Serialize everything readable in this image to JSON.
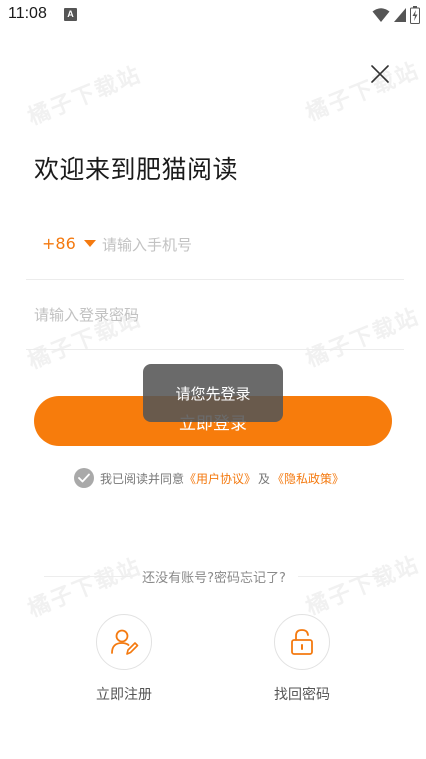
{
  "status_bar": {
    "time": "11:08",
    "notification_glyph": "A"
  },
  "watermark_text": "橘子下载站",
  "welcome_title": "欢迎来到肥猫阅读",
  "phone": {
    "country_code": "+86",
    "placeholder": "请输入手机号"
  },
  "password": {
    "placeholder": "请输入登录密码"
  },
  "login_button": "立即登录",
  "toast": "请您先登录",
  "agreement": {
    "prefix": "我已阅读并同意",
    "user_agreement": "《用户协议》",
    "joiner": "及",
    "privacy_policy": "《隐私政策》"
  },
  "divider_text": "还没有账号?密码忘记了?",
  "actions": {
    "register": {
      "label": "立即注册",
      "icon": "user-edit-icon"
    },
    "find_password": {
      "label": "找回密码",
      "icon": "unlock-icon"
    }
  },
  "colors": {
    "accent": "#f77c0c",
    "toast_bg": "#555555"
  }
}
